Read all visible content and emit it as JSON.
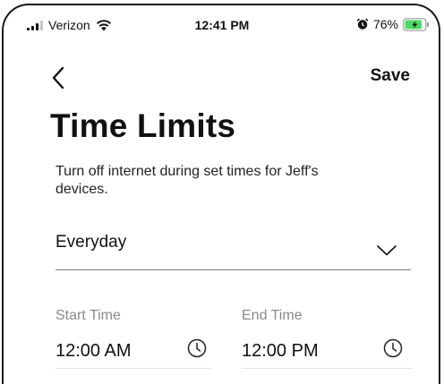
{
  "status_bar": {
    "carrier": "Verizon",
    "time": "12:41 PM",
    "battery": "76%"
  },
  "nav": {
    "save_label": "Save"
  },
  "page": {
    "title": "Time Limits",
    "description": "Turn off internet during set times for Jeff's devices."
  },
  "schedule": {
    "selected": "Everyday"
  },
  "start_time": {
    "label": "Start Time",
    "value": "12:00 AM"
  },
  "end_time": {
    "label": "End Time",
    "value": "12:00 PM"
  },
  "icons": [
    "signal-icon",
    "wifi-icon",
    "alarm-icon",
    "battery-icon",
    "chevron-left-icon",
    "chevron-down-icon",
    "clock-icon"
  ],
  "colors": {
    "text": "#111111",
    "muted_label": "#8a8a8a",
    "battery_charge": "#4cd964"
  }
}
